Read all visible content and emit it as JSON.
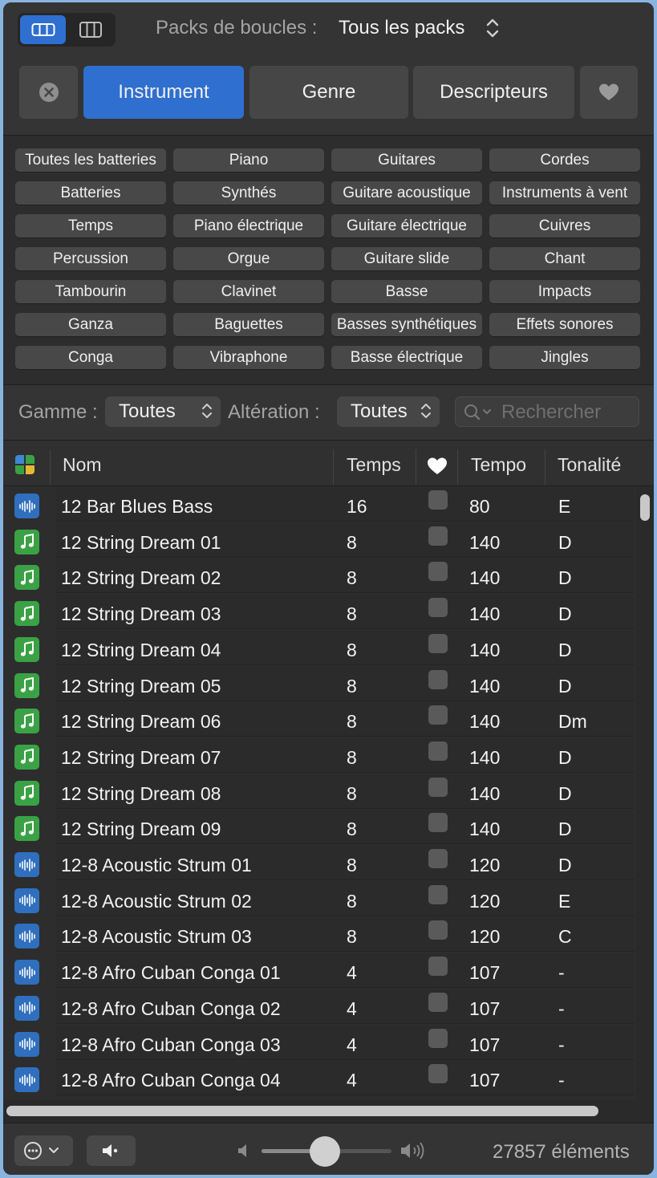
{
  "header": {
    "packs_label": "Packs de boucles :",
    "packs_value": "Tous les packs",
    "tabs": {
      "instrument": "Instrument",
      "genre": "Genre",
      "descriptors": "Descripteurs"
    },
    "active_color": "#2f6fcf"
  },
  "keywords": [
    "Toutes les batteries",
    "Piano",
    "Guitares",
    "Cordes",
    "Batteries",
    "Synthés",
    "Guitare acoustique",
    "Instruments à vent",
    "Temps",
    "Piano électrique",
    "Guitare électrique",
    "Cuivres",
    "Percussion",
    "Orgue",
    "Guitare slide",
    "Chant",
    "Tambourin",
    "Clavinet",
    "Basse",
    "Impacts",
    "Ganza",
    "Baguettes",
    "Basses synthétiques",
    "Effets sonores",
    "Conga",
    "Vibraphone",
    "Basse électrique",
    "Jingles"
  ],
  "filters": {
    "scale_label": "Gamme :",
    "scale_value": "Toutes",
    "accidental_label": "Altération :",
    "accidental_value": "Toutes",
    "search_placeholder": "Rechercher"
  },
  "table": {
    "columns": {
      "name": "Nom",
      "beats": "Temps",
      "tempo": "Tempo",
      "key": "Tonalité"
    },
    "rows": [
      {
        "type": "audio",
        "name": "12 Bar Blues Bass",
        "beats": "16",
        "tempo": "80",
        "key": "E"
      },
      {
        "type": "midi",
        "name": "12 String Dream 01",
        "beats": "8",
        "tempo": "140",
        "key": "D"
      },
      {
        "type": "midi",
        "name": "12 String Dream 02",
        "beats": "8",
        "tempo": "140",
        "key": "D"
      },
      {
        "type": "midi",
        "name": "12 String Dream 03",
        "beats": "8",
        "tempo": "140",
        "key": "D"
      },
      {
        "type": "midi",
        "name": "12 String Dream 04",
        "beats": "8",
        "tempo": "140",
        "key": "D"
      },
      {
        "type": "midi",
        "name": "12 String Dream 05",
        "beats": "8",
        "tempo": "140",
        "key": "D"
      },
      {
        "type": "midi",
        "name": "12 String Dream 06",
        "beats": "8",
        "tempo": "140",
        "key": "Dm"
      },
      {
        "type": "midi",
        "name": "12 String Dream 07",
        "beats": "8",
        "tempo": "140",
        "key": "D"
      },
      {
        "type": "midi",
        "name": "12 String Dream 08",
        "beats": "8",
        "tempo": "140",
        "key": "D"
      },
      {
        "type": "midi",
        "name": "12 String Dream 09",
        "beats": "8",
        "tempo": "140",
        "key": "D"
      },
      {
        "type": "audio",
        "name": "12-8 Acoustic Strum 01",
        "beats": "8",
        "tempo": "120",
        "key": "D"
      },
      {
        "type": "audio",
        "name": "12-8 Acoustic Strum 02",
        "beats": "8",
        "tempo": "120",
        "key": "E"
      },
      {
        "type": "audio",
        "name": "12-8 Acoustic Strum 03",
        "beats": "8",
        "tempo": "120",
        "key": "C"
      },
      {
        "type": "audio",
        "name": "12-8 Afro Cuban Conga 01",
        "beats": "4",
        "tempo": "107",
        "key": "-"
      },
      {
        "type": "audio",
        "name": "12-8 Afro Cuban Conga 02",
        "beats": "4",
        "tempo": "107",
        "key": "-"
      },
      {
        "type": "audio",
        "name": "12-8 Afro Cuban Conga 03",
        "beats": "4",
        "tempo": "107",
        "key": "-"
      },
      {
        "type": "audio",
        "name": "12-8 Afro Cuban Conga 04",
        "beats": "4",
        "tempo": "107",
        "key": "-"
      }
    ]
  },
  "footer": {
    "volume_fraction": 0.49,
    "count": "27857 éléments"
  },
  "icons": {
    "audio_loop": "waveform-icon",
    "midi_loop": "music-note-icon",
    "audio_color": "#2f6fbe",
    "midi_color": "#3aa245"
  }
}
